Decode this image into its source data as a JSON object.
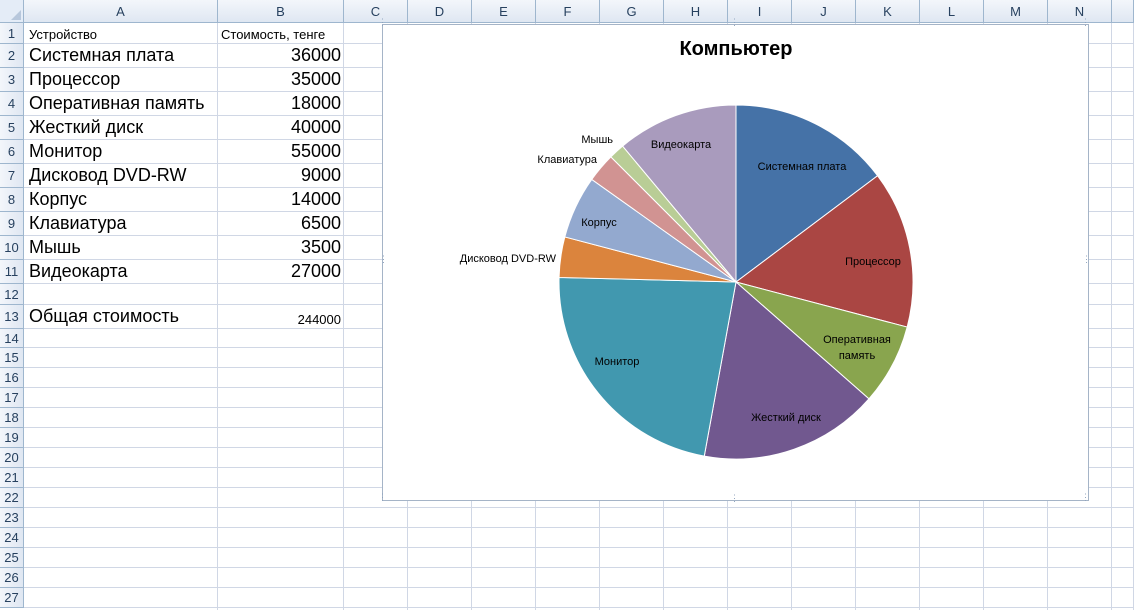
{
  "columns": [
    "A",
    "B",
    "C",
    "D",
    "E",
    "F",
    "G",
    "H",
    "I",
    "J",
    "K",
    "L",
    "M",
    "N"
  ],
  "rows": [
    "1",
    "2",
    "3",
    "4",
    "5",
    "6",
    "7",
    "8",
    "9",
    "10",
    "11",
    "12",
    "13",
    "14",
    "15",
    "16",
    "17",
    "18",
    "19",
    "20",
    "21",
    "22",
    "23",
    "24",
    "25",
    "26",
    "27"
  ],
  "table": {
    "header_device": "Устройство",
    "header_cost": "Стоимость, тенге",
    "items": [
      {
        "device": "Системная плата",
        "cost": "36000"
      },
      {
        "device": "Процессор",
        "cost": "35000"
      },
      {
        "device": "Оперативная память",
        "cost": "18000"
      },
      {
        "device": "Жесткий диск",
        "cost": "40000"
      },
      {
        "device": "Монитор",
        "cost": "55000"
      },
      {
        "device": "Дисковод DVD-RW",
        "cost": "9000"
      },
      {
        "device": "Корпус",
        "cost": "14000"
      },
      {
        "device": "Клавиатура",
        "cost": "6500"
      },
      {
        "device": "Мышь",
        "cost": "3500"
      },
      {
        "device": "Видеокарта",
        "cost": "27000"
      }
    ],
    "total_label": "Общая стоимость",
    "total_value": "244000"
  },
  "chart_data": {
    "type": "pie",
    "title": "Компьютер",
    "categories": [
      "Системная плата",
      "Процессор",
      "Оперативная память",
      "Жесткий диск",
      "Монитор",
      "Дисковод DVD-RW",
      "Корпус",
      "Клавиатура",
      "Мышь",
      "Видеокарта"
    ],
    "values": [
      36000,
      35000,
      18000,
      40000,
      55000,
      9000,
      14000,
      6500,
      3500,
      27000
    ],
    "colors": [
      "#4572a7",
      "#aa4643",
      "#89a54e",
      "#71588f",
      "#4198af",
      "#db843d",
      "#93a9cf",
      "#d19392",
      "#b9cd96",
      "#a99bbd"
    ],
    "data_labels": [
      "Системная плата",
      "Процессор",
      "Оперативная память",
      "Жесткий диск",
      "Монитор",
      "Дисковод DVD-RW",
      "Корпус",
      "Клавиатура",
      "Мышь",
      "Видеокарта"
    ],
    "legend": "none",
    "start_angle": "12 o'clock, clockwise"
  }
}
